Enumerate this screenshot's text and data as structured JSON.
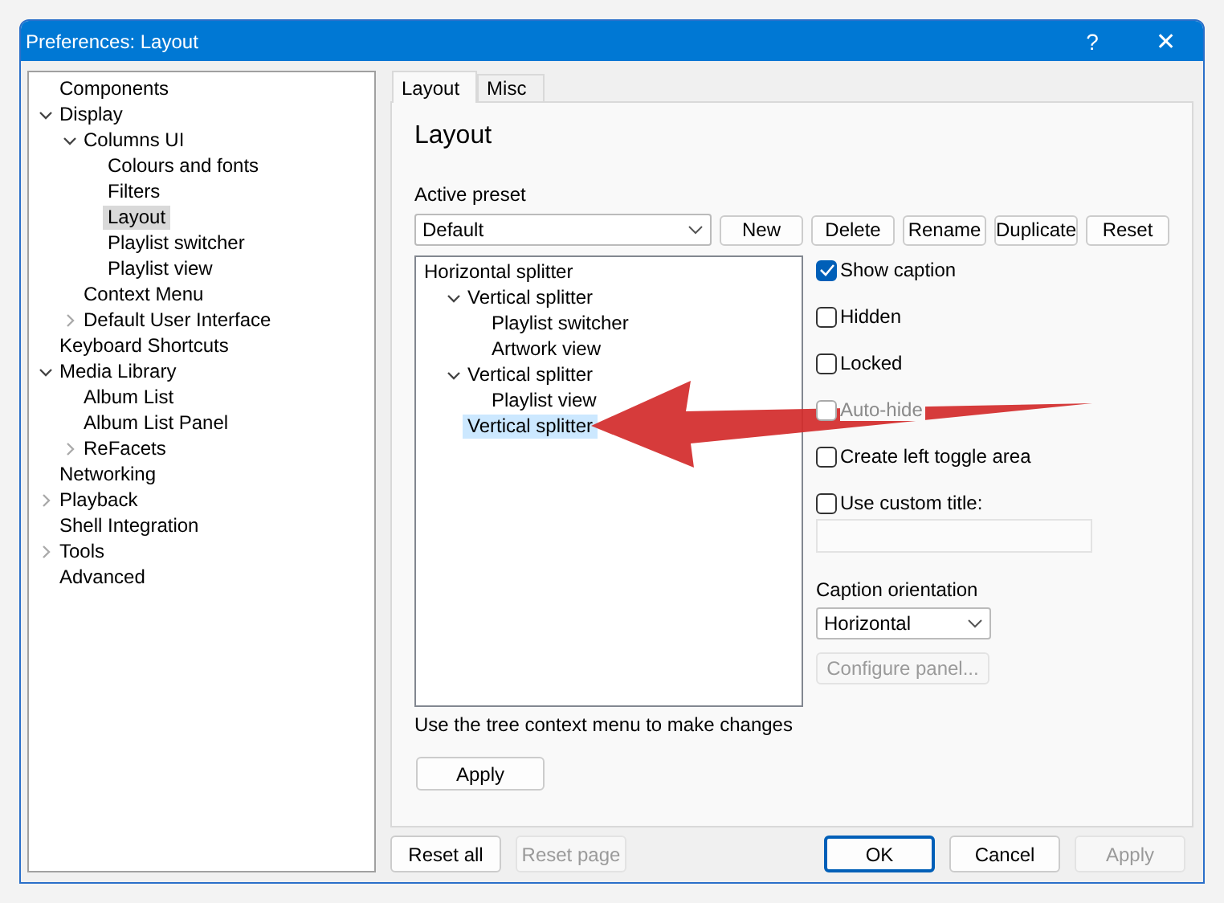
{
  "window": {
    "title": "Preferences: Layout",
    "help_button": "?",
    "close_button": "✕"
  },
  "sidebar": {
    "tree": [
      {
        "label": "Components",
        "selected": false
      },
      {
        "label": "Display",
        "selected": false,
        "expanded": true,
        "children": [
          {
            "label": "Columns UI",
            "selected": false,
            "expanded": true,
            "children": [
              {
                "label": "Colours and fonts",
                "selected": false
              },
              {
                "label": "Filters",
                "selected": false
              },
              {
                "label": "Layout",
                "selected": true
              },
              {
                "label": "Playlist switcher",
                "selected": false
              },
              {
                "label": "Playlist view",
                "selected": false
              }
            ]
          },
          {
            "label": "Context Menu",
            "selected": false
          },
          {
            "label": "Default User Interface",
            "selected": false,
            "expanded": false
          }
        ]
      },
      {
        "label": "Keyboard Shortcuts",
        "selected": false
      },
      {
        "label": "Media Library",
        "selected": false,
        "expanded": true,
        "children": [
          {
            "label": "Album List",
            "selected": false
          },
          {
            "label": "Album List Panel",
            "selected": false
          },
          {
            "label": "ReFacets",
            "selected": false,
            "expanded": false
          }
        ]
      },
      {
        "label": "Networking",
        "selected": false
      },
      {
        "label": "Playback",
        "selected": false,
        "expanded": false
      },
      {
        "label": "Shell Integration",
        "selected": false
      },
      {
        "label": "Tools",
        "selected": false,
        "expanded": false
      },
      {
        "label": "Advanced",
        "selected": false
      }
    ]
  },
  "tabs": [
    {
      "label": "Layout",
      "selected": true
    },
    {
      "label": "Misc",
      "selected": false
    }
  ],
  "page": {
    "heading": "Layout",
    "preset_label": "Active preset",
    "preset_value": "Default",
    "preset_buttons": [
      "New",
      "Delete",
      "Rename",
      "Duplicate",
      "Reset"
    ],
    "layout_tree": [
      {
        "label": "Horizontal splitter",
        "selected": false,
        "children": [
          {
            "label": "Vertical splitter",
            "selected": false,
            "expanded": true,
            "children": [
              {
                "label": "Playlist switcher",
                "selected": false
              },
              {
                "label": "Artwork view",
                "selected": false
              }
            ]
          },
          {
            "label": "Vertical splitter",
            "selected": false,
            "expanded": true,
            "children": [
              {
                "label": "Playlist view",
                "selected": false
              }
            ]
          },
          {
            "label": "Vertical splitter",
            "selected": true
          }
        ]
      }
    ],
    "options": [
      {
        "label": "Show caption",
        "checked": true,
        "disabled": false
      },
      {
        "label": "Hidden",
        "checked": false,
        "disabled": false
      },
      {
        "label": "Locked",
        "checked": false,
        "disabled": false
      },
      {
        "label": "Auto-hide",
        "checked": false,
        "disabled": true
      },
      {
        "label": "Create left toggle area",
        "checked": false,
        "disabled": false
      },
      {
        "label": "Use custom title:",
        "checked": false,
        "disabled": false
      }
    ],
    "custom_title": {
      "disabled": true
    },
    "orientation_label": "Caption orientation",
    "orientation_value": "Horizontal",
    "configure_button": {
      "label": "Configure panel...",
      "disabled": true
    },
    "hint": "Use the tree context menu to make changes",
    "apply_button": "Apply"
  },
  "footer_buttons": [
    {
      "label": "Reset all",
      "disabled": false,
      "default": false
    },
    {
      "label": "Reset page",
      "disabled": true,
      "default": false
    },
    {
      "label": "OK",
      "disabled": false,
      "default": true
    },
    {
      "label": "Cancel",
      "disabled": false,
      "default": false
    },
    {
      "label": "Apply",
      "disabled": true,
      "default": false
    }
  ]
}
